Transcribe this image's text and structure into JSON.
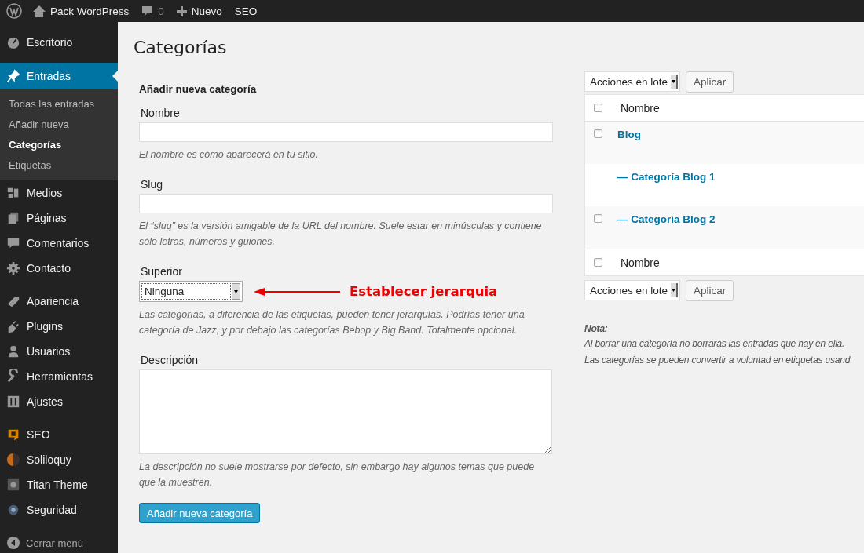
{
  "admin_bar": {
    "site": "Pack WordPress",
    "comments": "0",
    "new": "Nuevo",
    "seo": "SEO"
  },
  "sidebar": {
    "groups": [
      {
        "items": [
          {
            "label": "Escritorio",
            "selected": false
          }
        ]
      },
      {
        "items": [
          {
            "label": "Entradas",
            "selected": true,
            "children": [
              {
                "label": "Todas las entradas",
                "selected": false
              },
              {
                "label": "Añadir nueva",
                "selected": false
              },
              {
                "label": "Categorías",
                "selected": true
              },
              {
                "label": "Etiquetas",
                "selected": false
              }
            ]
          },
          {
            "label": "Medios",
            "selected": false
          },
          {
            "label": "Páginas",
            "selected": false
          },
          {
            "label": "Comentarios",
            "selected": false
          },
          {
            "label": "Contacto",
            "selected": false
          }
        ]
      },
      {
        "items": [
          {
            "label": "Apariencia",
            "selected": false
          },
          {
            "label": "Plugins",
            "selected": false
          },
          {
            "label": "Usuarios",
            "selected": false
          },
          {
            "label": "Herramientas",
            "selected": false
          },
          {
            "label": "Ajustes",
            "selected": false
          }
        ]
      },
      {
        "items": [
          {
            "label": "SEO",
            "selected": false
          },
          {
            "label": "Soliloquy",
            "selected": false
          },
          {
            "label": "Titan Theme",
            "selected": false
          },
          {
            "label": "Seguridad",
            "selected": false
          }
        ]
      }
    ],
    "collapse": "Cerrar menú"
  },
  "page_title": "Categorías",
  "form": {
    "heading": "Añadir nueva categoría",
    "fields": [
      {
        "kind": "text",
        "label": "Nombre",
        "hint": "El nombre es cómo aparecerá en tu sitio."
      },
      {
        "kind": "text",
        "label": "Slug",
        "hint": "El “slug” es la versión amigable de la URL del nombre. Suele estar en minúsculas y contiene sólo letras, números y guiones."
      },
      {
        "kind": "select",
        "label": "Superior",
        "value": "Ninguna",
        "annotation": "Establecer jerarquia",
        "hint": "Las categorías, a diferencia de las etiquetas, pueden tener jerarquías. Podrías tener una categoría de Jazz, y por debajo las categorías Bebop y Big Band. Totalmente opcional."
      },
      {
        "kind": "textarea",
        "label": "Descripción",
        "hint": "La descripción no suele mostrarse por defecto, sin embargo hay algunos temas que puede que la muestren."
      }
    ],
    "submit": "Añadir nueva categoría"
  },
  "table": {
    "bulk_top": {
      "action": "Acciones en lote",
      "apply": "Aplicar"
    },
    "header": {
      "label": "Nombre",
      "checked": false
    },
    "rows": [
      {
        "name": "Blog",
        "checkbox": true,
        "checked": false
      },
      {
        "name": "— Categoría Blog 1",
        "checkbox": false
      },
      {
        "name": "— Categoría Blog 2",
        "checkbox": true,
        "checked": false
      }
    ],
    "footer": {
      "label": "Nombre",
      "checked": false
    },
    "bulk_bottom": {
      "action": "Acciones en lote",
      "apply": "Aplicar"
    }
  },
  "note": {
    "title": "Nota:",
    "lines": [
      "Al borrar una categoría no borrarás las entradas que hay en ella.",
      "Las categorías se pueden convertir a voluntad en etiquetas usand"
    ]
  }
}
